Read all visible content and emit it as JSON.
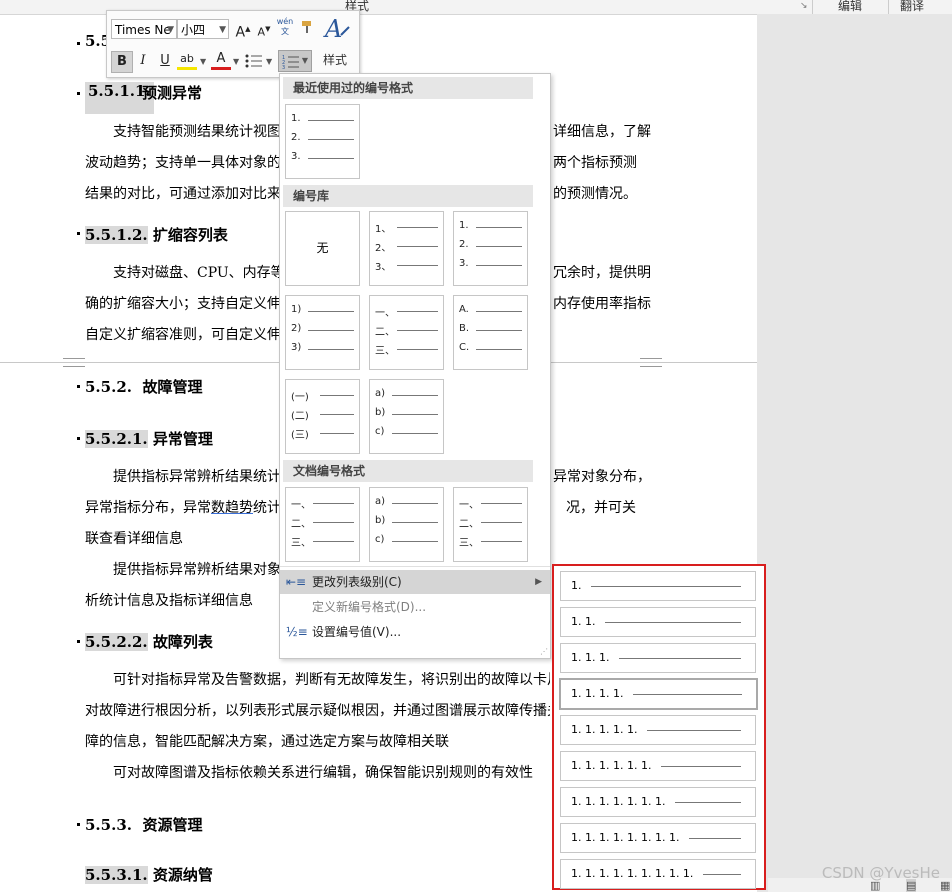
{
  "ribbon": {
    "styles_label": "样式",
    "edit_label": "编辑",
    "translate_label": "翻译"
  },
  "mini_toolbar": {
    "font_name": "Times Ne",
    "font_size": "小四",
    "grow_font": "A",
    "shrink_font": "A",
    "phonetic": "wén\n文",
    "bold": "B",
    "italic": "I",
    "underline": "U",
    "highlight": "ab",
    "font_color": "A",
    "styles_label": "样式"
  },
  "doc": {
    "h1": "5.5",
    "h2": {
      "num": "5.5.1.1.",
      "title": "预测异常"
    },
    "p1": [
      "支持智能预测结果统计视图",
      "详细信息，了解",
      "波动趋势；支持单一具体对象的",
      "两个指标预测",
      "结果的对比，可通过添加对比来",
      "的预测情况。"
    ],
    "h3": {
      "num": "5.5.1.2.",
      "title": "扩缩容列表"
    },
    "p2": [
      "支持对磁盘、CPU、内存等",
      "冗余时，提供明",
      "确的扩缩容大小；支持自定义伸",
      "内存使用率指标",
      "自定义扩缩容准则，可自定义伸"
    ],
    "h4": {
      "num": "5.5.2.",
      "title": "故障管理"
    },
    "h5": {
      "num": "5.5.2.1.",
      "title": "异常管理"
    },
    "p3": [
      "提供指标异常辨析结果统计",
      "异常对象分布，",
      "异常指标分布，异常",
      "数趋势",
      "统计",
      "况，并可关",
      "联查看详细信息"
    ],
    "p4": [
      "提供指标异常辨析结果对象",
      "析统计信息及指标详细信息"
    ],
    "h6": {
      "num": "5.5.2.2.",
      "title": "故障列表"
    },
    "p5": [
      "可针对指标异常及告警数据，判断有无故障发生，将识别出的故障以卡片",
      "对故障进行根因分析，以列表形式展示疑似根因，并通过图谱展示故障传播关",
      "障的信息，智能匹配解决方案，通过选定方案与故障相关联"
    ],
    "p6": "可对故障图谱及指标依赖关系进行编辑，确保智能识别规则的有效性",
    "h7": {
      "num": "5.5.3.",
      "title": "资源管理"
    },
    "h8": {
      "num": "5.5.3.1.",
      "title": "资源纳管"
    }
  },
  "numbering_menu": {
    "recent_header": "最近使用过的编号格式",
    "recent": [
      "1.",
      "2.",
      "3."
    ],
    "library_header": "编号库",
    "none_label": "无",
    "library": [
      [
        "1、",
        "2、",
        "3、"
      ],
      [
        "1.",
        "2.",
        "3."
      ],
      [
        "1)",
        "2)",
        "3)"
      ],
      [
        "一、",
        "二、",
        "三、"
      ],
      [
        "A.",
        "B.",
        "C."
      ],
      [
        "(一)",
        "(二)",
        "(三)"
      ],
      [
        "a)",
        "b)",
        "c)"
      ]
    ],
    "doc_header": "文档编号格式",
    "doc_formats": [
      [
        "一、",
        "二、",
        "三、"
      ],
      [
        "a)",
        "b)",
        "c)"
      ],
      [
        "一、",
        "二、",
        "三、"
      ]
    ],
    "change_level": "更改列表级别(C)",
    "define_new": "定义新编号格式(D)...",
    "set_value": "设置编号值(V)..."
  },
  "level_submenu": {
    "levels": [
      "1.",
      "1. 1.",
      "1. 1. 1.",
      "1. 1. 1. 1.",
      "1. 1. 1. 1. 1.",
      "1. 1. 1. 1. 1. 1.",
      "1. 1. 1. 1. 1. 1. 1.",
      "1. 1. 1. 1. 1. 1. 1. 1.",
      "1. 1. 1. 1. 1. 1. 1. 1. 1."
    ],
    "selected_index": 3
  },
  "watermark": "CSDN @YvesHe",
  "colors": {
    "highlight_red": "#d81e1e",
    "accent_blue": "#2b579a"
  }
}
